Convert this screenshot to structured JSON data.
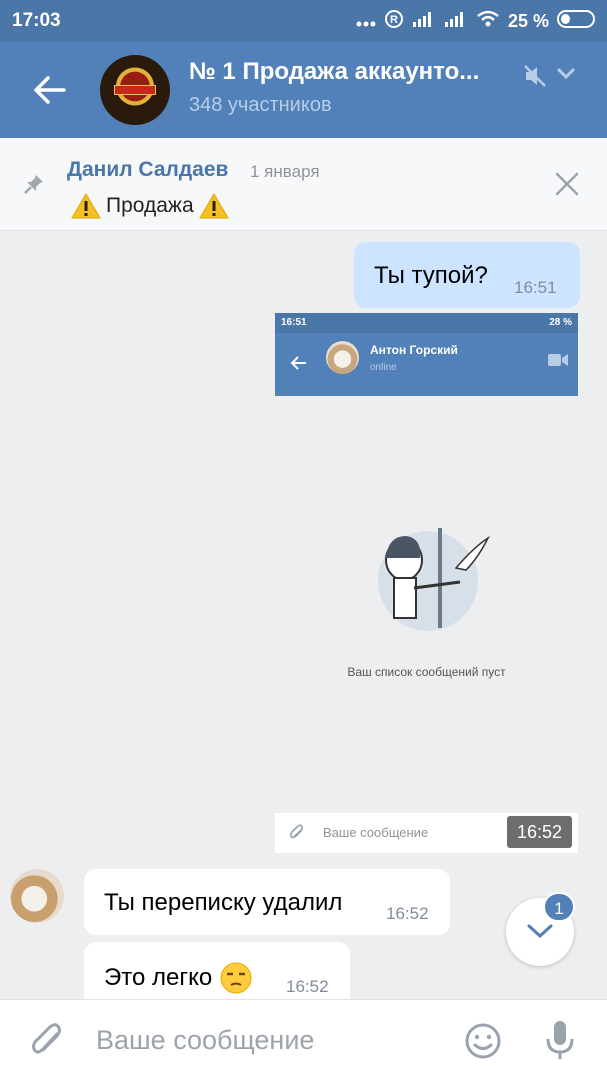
{
  "status_bar": {
    "time": "17:03",
    "battery": "25 %"
  },
  "header": {
    "title": "№ 1 Продажа аккаунто...",
    "subtitle": "348 участников"
  },
  "pinned": {
    "author": "Данил Салдаев",
    "date": "1 января",
    "text": "Продажа"
  },
  "messages": [
    {
      "direction": "out",
      "text": "Ты тупой?",
      "time": "16:51"
    },
    {
      "direction": "in",
      "text": "Ты переписку удалил",
      "time": "16:52"
    },
    {
      "direction": "in",
      "text": "Это легко",
      "time": "16:52"
    }
  ],
  "attachment_screenshot": {
    "status_time": "16:51",
    "status_battery": "28 %",
    "contact_name": "Антон Горский",
    "contact_status": "online",
    "empty_text": "Ваш список сообщений пуст",
    "input_placeholder": "Ваше сообщение",
    "time_overlay": "16:52"
  },
  "scroll_button": {
    "unread_count": "1"
  },
  "composer": {
    "placeholder": "Ваше сообщение"
  },
  "colors": {
    "header": "#5181b8",
    "status_bar": "#4a76a8",
    "outgoing_bubble": "#cce4ff",
    "background": "#edeef0"
  }
}
